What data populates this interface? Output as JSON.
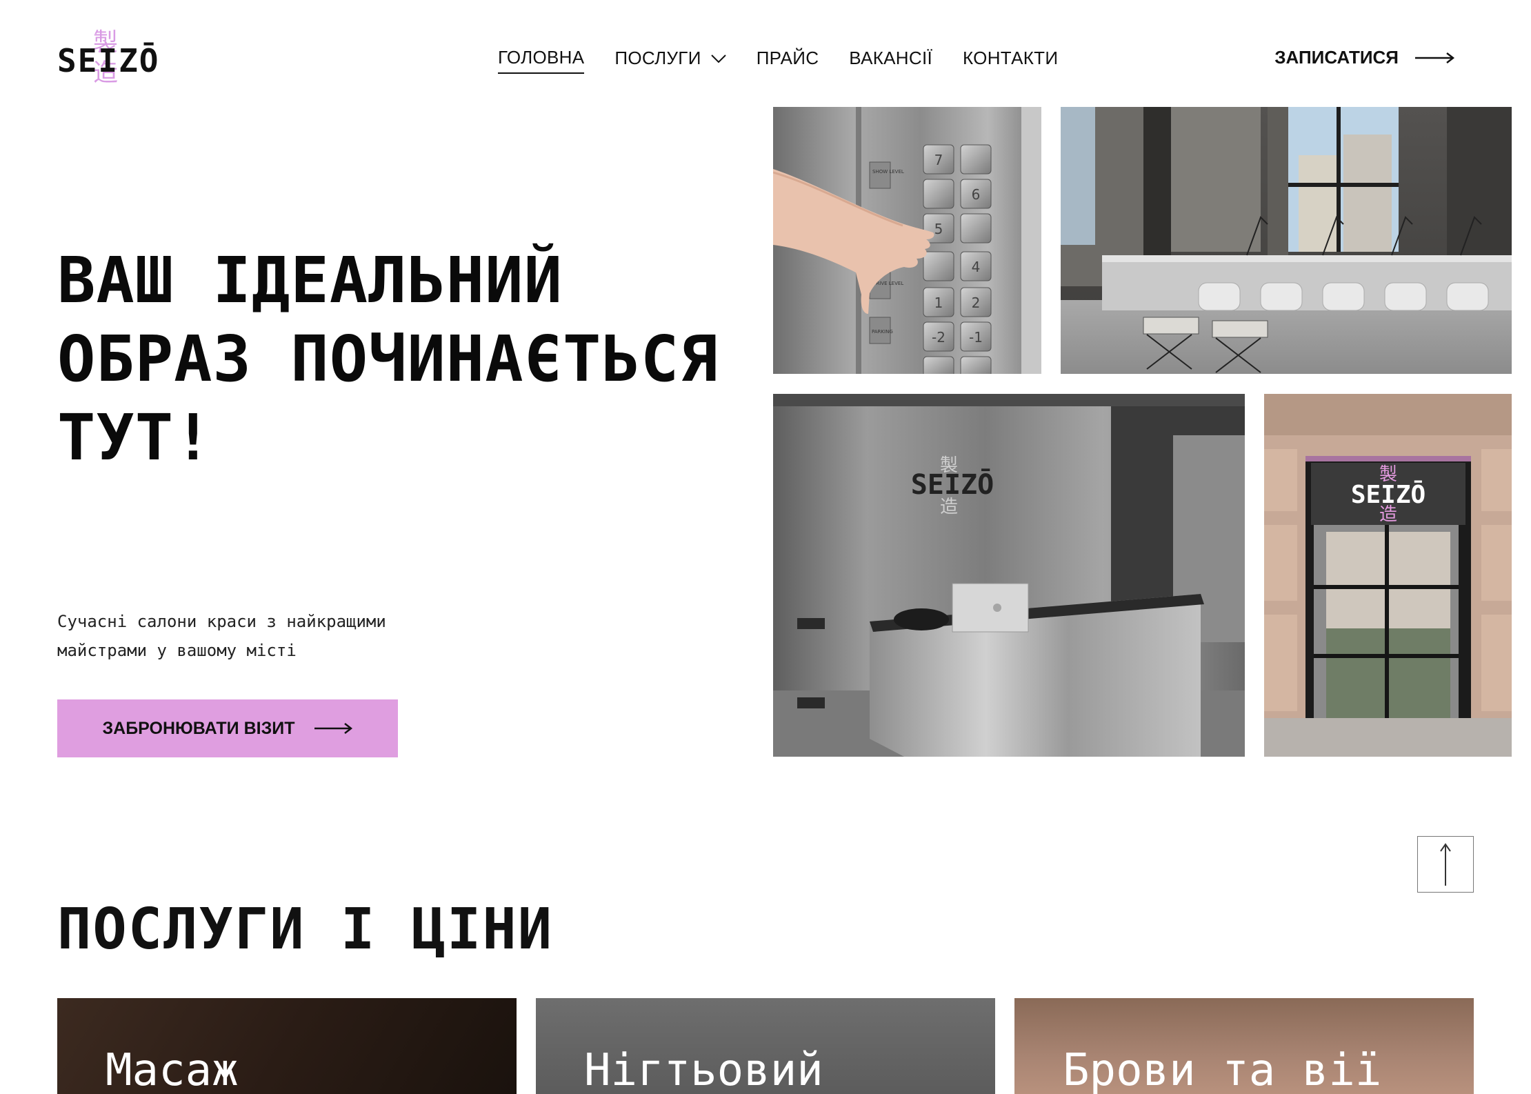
{
  "brand": {
    "name": "SEIZŌ",
    "kanji_top": "製",
    "kanji_bottom": "造",
    "accent": "#df9ee0"
  },
  "nav": {
    "items": [
      {
        "label": "ГОЛОВНА",
        "active": true
      },
      {
        "label": "ПОСЛУГИ",
        "dropdown": true
      },
      {
        "label": "ПРАЙС"
      },
      {
        "label": "ВАКАНСІЇ"
      },
      {
        "label": "КОНТАКТИ"
      }
    ],
    "cta": "ЗАПИСАТИСЯ"
  },
  "hero": {
    "title_line1": "ВАШ ІДЕАЛЬНИЙ",
    "title_line2": "ОБРАЗ ПОЧИНАЄТЬСЯ",
    "title_line3": "ТУТ!",
    "subtitle_line1": "Сучасні салони краси з найкращими",
    "subtitle_line2": "майстрами у вашому місті",
    "button": "ЗАБРОНЮВАТИ ВІЗИТ"
  },
  "gallery": {
    "elevator_labels": [
      "SHOW LEVEL",
      "DRIVE LEVEL",
      "PARKING"
    ],
    "elevator_numbers": [
      "7",
      "6",
      "5",
      "4",
      "1",
      "2",
      "-2",
      "-1"
    ],
    "reception_sign": "SEIZŌ",
    "entrance_sign": "SEIZŌ"
  },
  "services": {
    "title": "ПОСЛУГИ І ЦІНИ",
    "cards": [
      {
        "label": "Масаж"
      },
      {
        "label": "Нігтьовий"
      },
      {
        "label": "Брови та вії"
      }
    ]
  }
}
